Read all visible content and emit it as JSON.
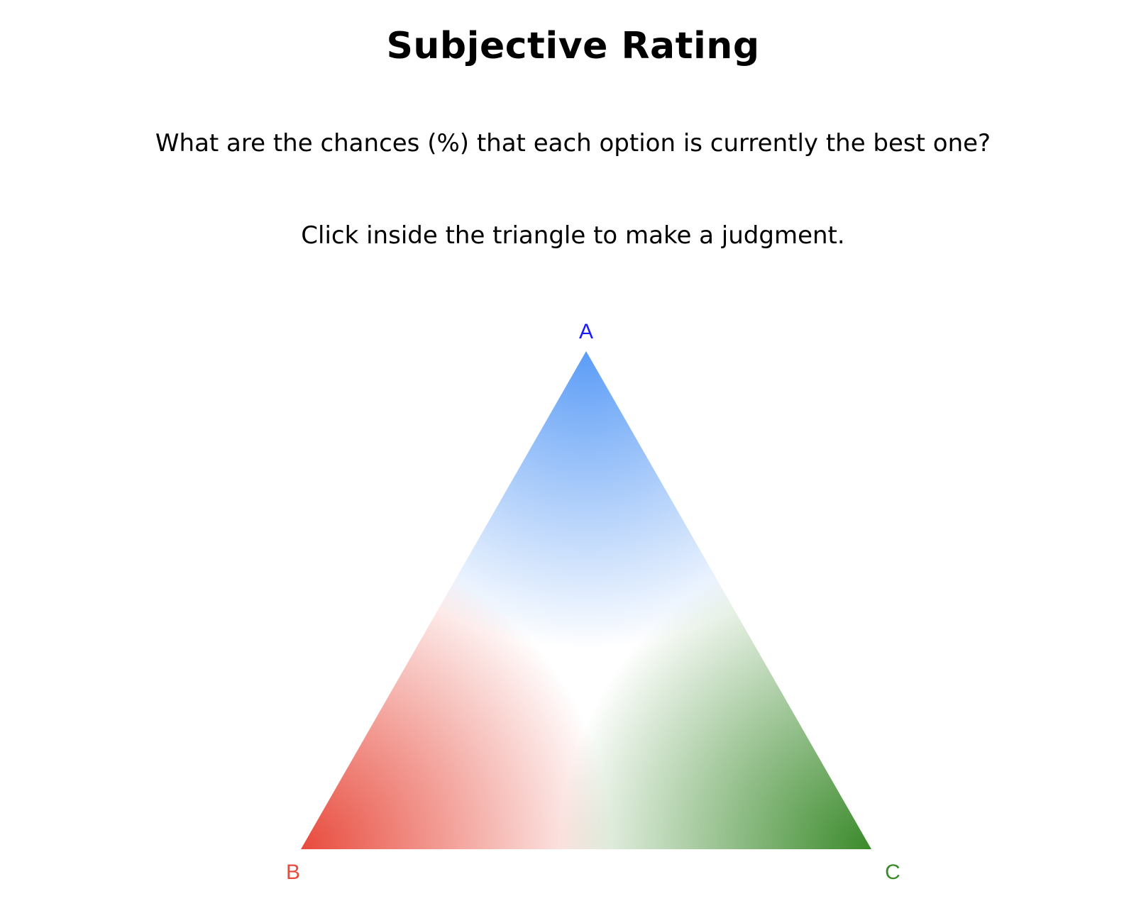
{
  "page": {
    "title": "Subjective Rating",
    "question": "What are the chances (%) that each option is currently the best one?",
    "instruction": "Click inside the triangle to make a judgment."
  },
  "triangle": {
    "vertices": [
      {
        "label": "A",
        "color": "#1a1aff",
        "fill": "#5b9cf6"
      },
      {
        "label": "B",
        "color": "#e84a3c",
        "fill": "#e84a3c"
      },
      {
        "label": "C",
        "color": "#3a8a2a",
        "fill": "#3a8a2a"
      }
    ]
  }
}
